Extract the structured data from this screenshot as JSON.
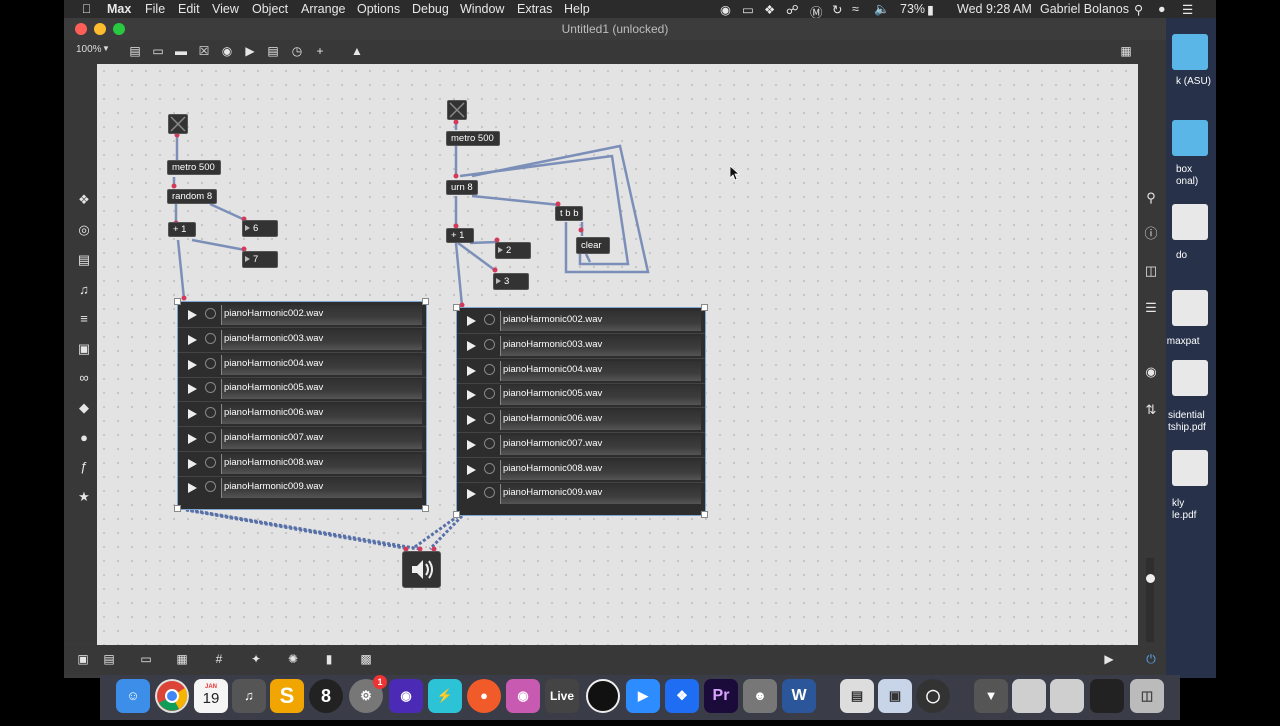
{
  "menubar": {
    "app": "Max",
    "items": [
      "File",
      "Edit",
      "View",
      "Object",
      "Arrange",
      "Options",
      "Debug",
      "Window",
      "Extras",
      "Help"
    ],
    "battery": "73%",
    "clock": "Wed 9:28 AM",
    "user": "Gabriel Bolanos"
  },
  "window": {
    "title": "Untitled1 (unlocked)",
    "zoom": "100%"
  },
  "patch": {
    "left": {
      "metro": "metro 500",
      "random": "random 8",
      "plus": "+ 1",
      "num_a": "6",
      "num_b": "7"
    },
    "right": {
      "metro": "metro 500",
      "urn": "urn 8",
      "plus": "+ 1",
      "tbb": "t b b",
      "clear": "clear",
      "num_a": "2",
      "num_b": "3"
    },
    "playlist_left": [
      "pianoHarmonic002.wav",
      "pianoHarmonic003.wav",
      "pianoHarmonic004.wav",
      "pianoHarmonic005.wav",
      "pianoHarmonic006.wav",
      "pianoHarmonic007.wav",
      "pianoHarmonic008.wav",
      "pianoHarmonic009.wav"
    ],
    "playlist_right": [
      "pianoHarmonic002.wav",
      "pianoHarmonic003.wav",
      "pianoHarmonic004.wav",
      "pianoHarmonic005.wav",
      "pianoHarmonic006.wav",
      "pianoHarmonic007.wav",
      "pianoHarmonic008.wav",
      "pianoHarmonic009.wav"
    ]
  },
  "desktop": {
    "labels": [
      "k (ASU)",
      "box",
      "onal)",
      "do",
      ".maxpat",
      "sidential",
      "tship.pdf",
      "kly",
      "le.pdf"
    ]
  },
  "dock": {
    "calendar_month": "JAN",
    "calendar_day": "19",
    "badge": "1",
    "live": "Live",
    "premiere": "Pr",
    "word": "W"
  },
  "colors": {
    "canvas": "#e3e3e3",
    "patchcord": "#7b8fb8",
    "selection": "#7fa7d6"
  }
}
